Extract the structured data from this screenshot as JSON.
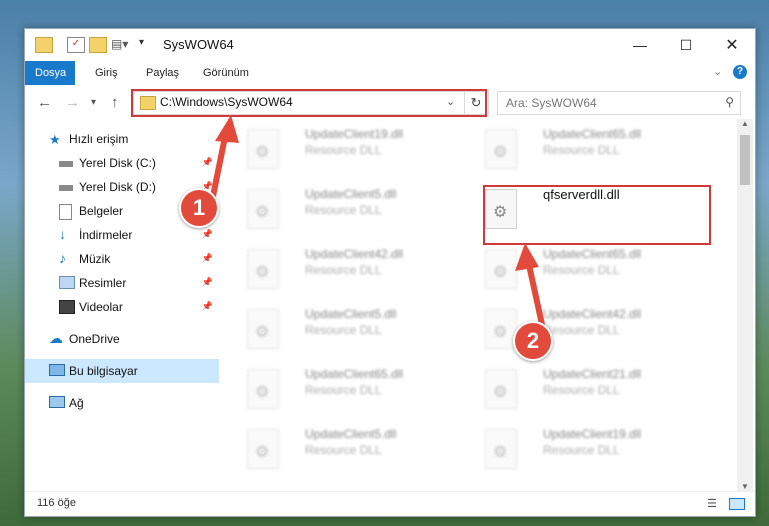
{
  "window": {
    "title": "SysWOW64"
  },
  "ribbon": {
    "tabs": [
      "Dosya",
      "Giriş",
      "Paylaş",
      "Görünüm"
    ]
  },
  "address": {
    "path": "C:\\Windows\\SysWOW64"
  },
  "search": {
    "placeholder": "Ara: SysWOW64"
  },
  "sidebar": {
    "items": [
      "Hızlı erişim",
      "Yerel Disk (C:)",
      "Yerel Disk (D:)",
      "Belgeler",
      "İndirmeler",
      "Müzik",
      "Resimler",
      "Videolar",
      "OneDrive",
      "Bu bilgisayar",
      "Ağ"
    ]
  },
  "files": {
    "left": [
      {
        "name": "UpdateClient19.dll",
        "type": "Resource DLL"
      },
      {
        "name": "UpdateClient5.dll",
        "type": "Resource DLL"
      },
      {
        "name": "UpdateClient42.dll",
        "type": "Resource DLL"
      },
      {
        "name": "UpdateClient5.dll",
        "type": "Resource DLL"
      },
      {
        "name": "UpdateClient65.dll",
        "type": "Resource DLL"
      },
      {
        "name": "UpdateClient5.dll",
        "type": "Resource DLL"
      }
    ],
    "right": [
      {
        "name": "UpdateClient65.dll",
        "type": "Resource DLL"
      },
      {
        "name": "qfserverdll.dll",
        "type": ""
      },
      {
        "name": "UpdateClient65.dll",
        "type": "Resource DLL"
      },
      {
        "name": "UpdateClient42.dll",
        "type": "Resource DLL"
      },
      {
        "name": "UpdateClient21.dll",
        "type": "Resource DLL"
      },
      {
        "name": "UpdateClient19.dll",
        "type": "Resource DLL"
      }
    ]
  },
  "status": {
    "count": "116 öğe"
  },
  "annotations": {
    "badge1": "1",
    "badge2": "2",
    "color": "#d0393a"
  }
}
